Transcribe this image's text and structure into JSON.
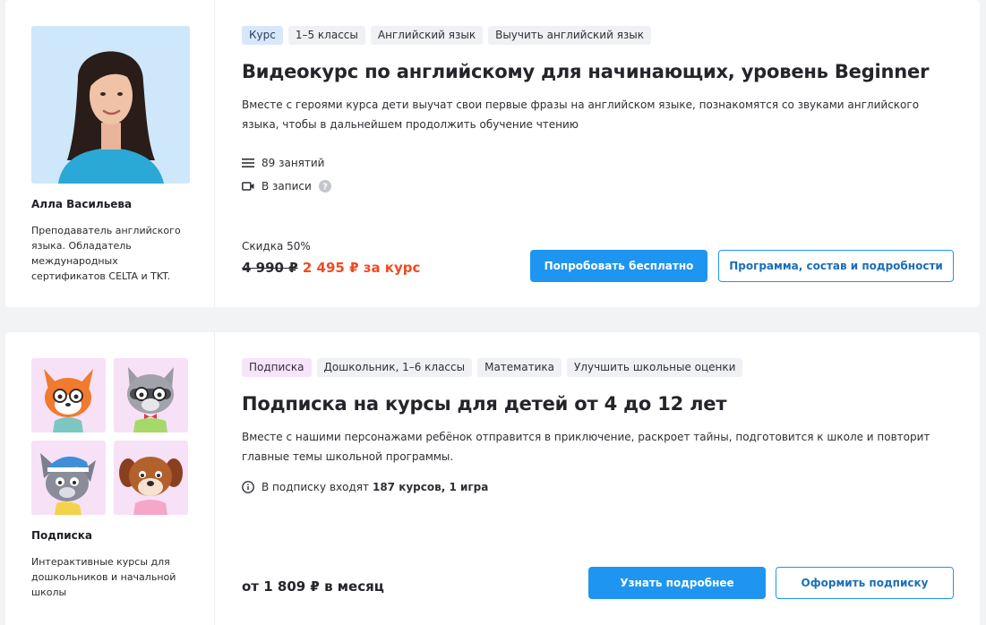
{
  "card1": {
    "author": {
      "name": "Алла Васильева",
      "description": "Преподаватель английского языка. Обладатель международных сертификатов CELTA и TKT."
    },
    "tags": [
      "Курс",
      "1–5 классы",
      "Английский язык",
      "Выучить английский язык"
    ],
    "title": "Видеокурс по английскому для начинающих, уровень Beginner",
    "description": "Вместе с героями курса дети выучат свои первые фразы на английском языке, познакомятся со звуками английского языка, чтобы в дальнейшем продолжить обучение чтению",
    "lessons": "89 занятий",
    "format": "В записи",
    "discount": "Скидка 50%",
    "old_price": "4 990 ₽",
    "new_price": "2 495 ₽ за курс",
    "try_button": "Попробовать бесплатно",
    "program_button": "Программа, состав и подробности"
  },
  "card2": {
    "author": {
      "name": "Подписка",
      "description": "Интерактивные курсы для дошкольников и начальной школы"
    },
    "tags": [
      "Подписка",
      "Дошкольник, 1–6 классы",
      "Математика",
      "Улучшить школьные оценки"
    ],
    "title": "Подписка на курсы для детей от 4 до 12 лет",
    "description": "Вместе с нашими персонажами ребёнок отправится в приключение, раскроет тайны, подготовится к школе и повторит главные темы школьной программы.",
    "includes_prefix": "В подписку входят ",
    "includes_bold": "187 курсов, 1 игра",
    "price": "от 1 809 ₽ в месяц",
    "learn_button": "Узнать подробнее",
    "subscribe_button": "Оформить подписку"
  },
  "colors": {
    "accent": "#1e95f0",
    "sale": "#f04b22",
    "course_tag": "#d7e8fb",
    "subscription_tag": "#f6e4f8"
  },
  "icons": [
    "list-icon",
    "video-icon",
    "help-icon",
    "info-icon"
  ]
}
